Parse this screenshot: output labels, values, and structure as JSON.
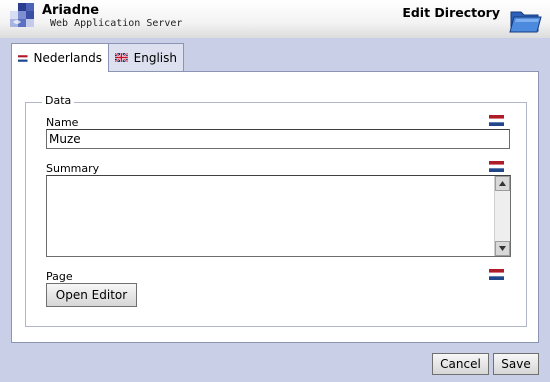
{
  "header": {
    "app_title": "Ariadne",
    "app_subtitle": "Web Application Server",
    "dialog_title": "Edit Directory"
  },
  "tabs": [
    {
      "label": "Nederlands",
      "flag": "flag-nl-icon",
      "active": true
    },
    {
      "label": "English",
      "flag": "flag-uk-icon",
      "active": false
    }
  ],
  "form": {
    "legend": "Data",
    "name_label": "Name",
    "name_value": "Muze",
    "summary_label": "Summary",
    "summary_value": "",
    "page_label": "Page",
    "open_editor_label": "Open Editor"
  },
  "footer": {
    "cancel_label": "Cancel",
    "save_label": "Save"
  },
  "colors": {
    "background": "#c9cfe6",
    "panel": "#ffffff",
    "border": "#8c94b4"
  }
}
